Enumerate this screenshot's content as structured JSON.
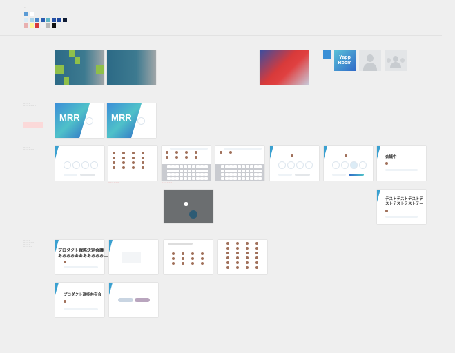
{
  "palette": {
    "label": "Colors",
    "row1": [
      "#5b9bd5",
      "#ffffff"
    ],
    "row2": [
      "#d9ecf7",
      "#a9d4ea",
      "#4a86c8",
      "#2a5db0",
      "#5fb6c6",
      "#2450a5",
      "#1f4aa0",
      "#0d1a33"
    ],
    "row3": [
      "#e8b0b0",
      "#fff59a",
      "#d63a3a",
      "#f2f2f2",
      "#b8b8b8",
      "#111111"
    ]
  },
  "app_icon": {
    "line1": "Yapp",
    "line2": "Room",
    "color": "#3a8fd6"
  },
  "placeholders": {
    "person": "person-icon",
    "group": "group-icon"
  },
  "mrr": {
    "title": "MRR"
  },
  "boards": {
    "meeting_title": "会議中",
    "test_title_line1": "テストテストテストテ",
    "test_title_line2": "ストテストテストテ—",
    "strategy_line1": "プロダクト戦略決定会議",
    "strategy_line2": "あああああああああああ…",
    "progress_title": "プロダクト進捗共有会"
  },
  "accent": "#3aa0d0"
}
